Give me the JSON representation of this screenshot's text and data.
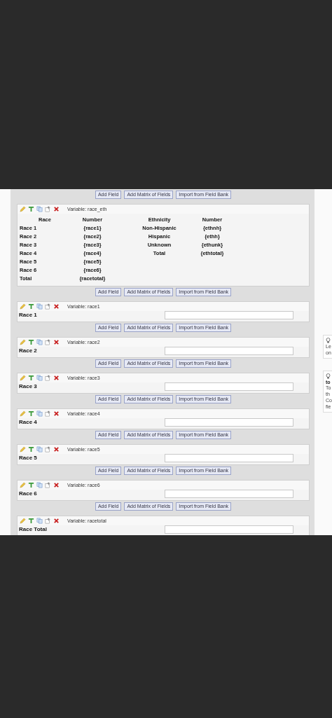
{
  "fields": [
    {
      "kind": "matrix",
      "buttons_above": [
        "Add Field",
        "Add Matrix of Fields",
        "Import from Field Bank"
      ],
      "variable": "Variable: race_eth",
      "headers": [
        "Race",
        "Number",
        "Ethnicity",
        "Number"
      ],
      "rows": [
        [
          "Race 1",
          "{race1}",
          "Non-Hispanic",
          "{ethnh}"
        ],
        [
          "Race 2",
          "{race2}",
          "Hispanic",
          "{ethh}"
        ],
        [
          "Race 3",
          "{race3}",
          "Unknown",
          "{ethunk}"
        ],
        [
          "Race 4",
          "{race4}",
          "Total",
          "{ethtotal}"
        ],
        [
          "Race 5",
          "{race5}",
          "",
          ""
        ],
        [
          "Race 6",
          "{race6}",
          "",
          ""
        ],
        [
          "Total",
          "{racetotal}",
          "",
          ""
        ]
      ]
    },
    {
      "kind": "text",
      "buttons_above": [
        "Add Field",
        "Add Matrix of Fields",
        "Import from Field Bank"
      ],
      "variable": "Variable: race1",
      "label": "Race 1"
    },
    {
      "kind": "text",
      "buttons_above": [
        "Add Field",
        "Add Matrix of Fields",
        "Import from Field Bank"
      ],
      "variable": "Variable: race2",
      "label": "Race 2"
    },
    {
      "kind": "text",
      "buttons_above": [
        "Add Field",
        "Add Matrix of Fields",
        "Import from Field Bank"
      ],
      "variable": "Variable: race3",
      "label": "Race 3"
    },
    {
      "kind": "text",
      "buttons_above": [
        "Add Field",
        "Add Matrix of Fields",
        "Import from Field Bank"
      ],
      "variable": "Variable: race4",
      "label": "Race 4"
    },
    {
      "kind": "text",
      "buttons_above": [
        "Add Field",
        "Add Matrix of Fields",
        "Import from Field Bank"
      ],
      "variable": "Variable: race5",
      "label": "Race 5"
    },
    {
      "kind": "text",
      "buttons_above": [
        "Add Field",
        "Add Matrix of Fields",
        "Import from Field Bank"
      ],
      "variable": "Variable: race6",
      "label": "Race 6"
    },
    {
      "kind": "text",
      "buttons_above": [
        "Add Field",
        "Add Matrix of Fields",
        "Import from Field Bank"
      ],
      "variable": "Variable: racetotal",
      "label": "Race Total"
    }
  ],
  "tips": [
    {
      "lines": [
        "Le",
        "on"
      ]
    },
    {
      "title": "to",
      "lines": [
        "To",
        "th",
        "Co",
        "fie"
      ]
    }
  ]
}
